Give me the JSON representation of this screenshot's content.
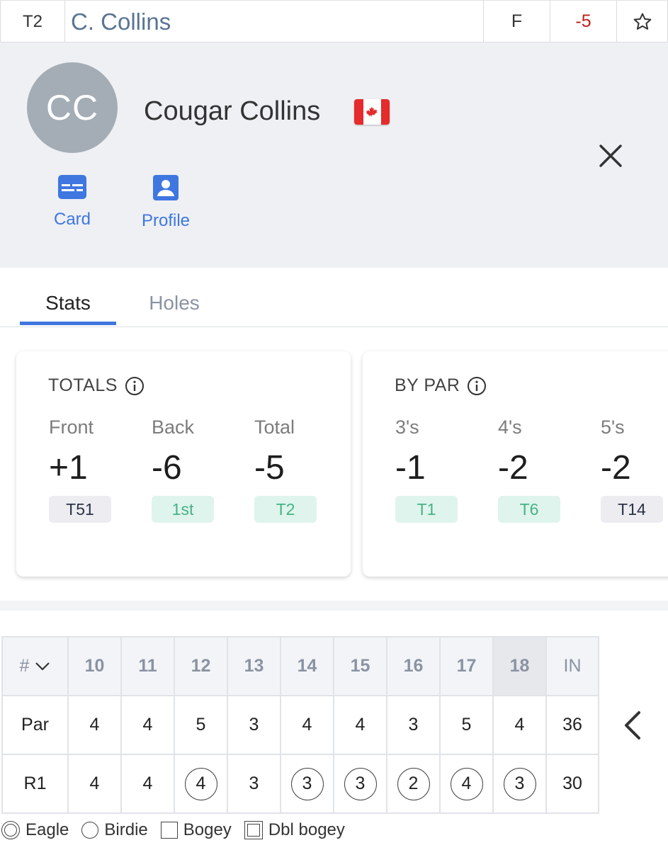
{
  "leaderboard_row": {
    "position": "T2",
    "name": "C. Collins",
    "thru": "F",
    "score": "-5",
    "favorite_icon": "star-icon"
  },
  "player": {
    "initials": "CC",
    "full_name": "Cougar Collins",
    "flag_icon": "canada-flag-icon",
    "close_icon": "close-icon",
    "actions": [
      {
        "label": "Card",
        "icon": "scorecard-icon"
      },
      {
        "label": "Profile",
        "icon": "profile-icon"
      }
    ]
  },
  "tabs": [
    {
      "label": "Stats",
      "active": true
    },
    {
      "label": "Holes",
      "active": false
    }
  ],
  "totals_card": {
    "title": "TOTALS",
    "stats": [
      {
        "label": "Front",
        "value": "+1",
        "rank": "T51",
        "rank_style": "gray"
      },
      {
        "label": "Back",
        "value": "-6",
        "rank": "1st",
        "rank_style": "green"
      },
      {
        "label": "Total",
        "value": "-5",
        "rank": "T2",
        "rank_style": "green"
      }
    ]
  },
  "by_par_card": {
    "title": "BY PAR",
    "stats": [
      {
        "label": "3's",
        "value": "-1",
        "rank": "T1",
        "rank_style": "green"
      },
      {
        "label": "4's",
        "value": "-2",
        "rank": "T6",
        "rank_style": "green"
      },
      {
        "label": "5's",
        "value": "-2",
        "rank": "T14",
        "rank_style": "gray"
      }
    ]
  },
  "scorecard": {
    "sort_label": "#",
    "holes": [
      "10",
      "11",
      "12",
      "13",
      "14",
      "15",
      "16",
      "17",
      "18"
    ],
    "total_label": "IN",
    "highlighted_hole": "18",
    "par": {
      "label": "Par",
      "values": [
        "4",
        "4",
        "5",
        "3",
        "4",
        "4",
        "3",
        "5",
        "4"
      ],
      "total": "36"
    },
    "rounds": [
      {
        "label": "R1",
        "values": [
          "4",
          "4",
          "4",
          "3",
          "3",
          "3",
          "2",
          "4",
          "3"
        ],
        "birdies": [
          false,
          false,
          true,
          false,
          true,
          true,
          true,
          true,
          true
        ],
        "total": "30"
      }
    ],
    "prev_icon": "chevron-left-icon"
  },
  "legend": [
    {
      "label": "Eagle",
      "icon": "eagle-marker-icon"
    },
    {
      "label": "Birdie",
      "icon": "birdie-marker-icon"
    },
    {
      "label": "Bogey",
      "icon": "bogey-marker-icon"
    },
    {
      "label": "Dbl bogey",
      "icon": "double-bogey-marker-icon"
    }
  ],
  "colors": {
    "accent_blue": "#3f76e0",
    "under_par_red": "#c0201c",
    "rank_green_text": "#46b286",
    "rank_green_bg": "#dff4ec",
    "rank_gray_bg": "#ececf1",
    "header_bg": "#eef0f4"
  }
}
